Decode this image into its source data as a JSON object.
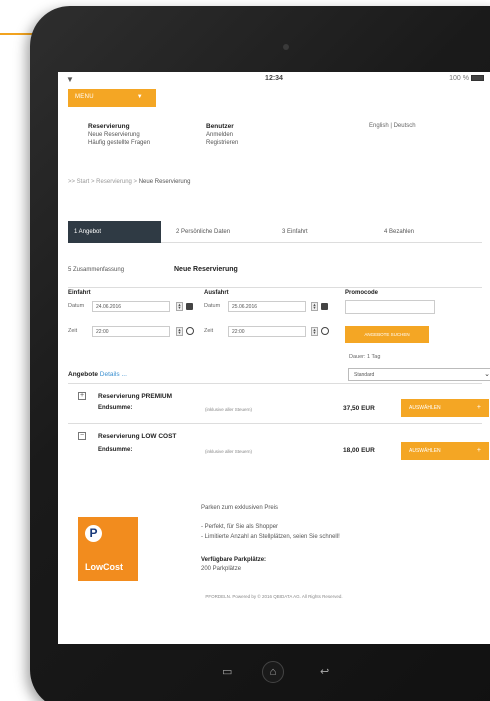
{
  "status": {
    "time": "12:34",
    "battery": "100 %"
  },
  "menu": {
    "label": "MENU"
  },
  "nav": {
    "col1": {
      "heading": "Reservierung",
      "items": [
        "Neue Reservierung",
        "Häufig gestellte Fragen"
      ]
    },
    "col2": {
      "heading": "Benutzer",
      "items": [
        "Anmelden",
        "Registrieren"
      ]
    },
    "languages": "English | Deutsch"
  },
  "breadcrumb": {
    "prefix": ">> Start > Reservierung > ",
    "current": "Neue Reservierung"
  },
  "steps": [
    "1 Angebot",
    "2 Persönliche Daten",
    "3 Einfahrt",
    "4 Bezahlen"
  ],
  "step5": "5 Zusammenfassung",
  "page_title": "Neue Reservierung",
  "form": {
    "einfahrt": {
      "heading": "Einfahrt",
      "datum_label": "Datum",
      "datum_value": "24.06.2016",
      "zeit_label": "Zeit",
      "zeit_value": "22:00"
    },
    "ausfahrt": {
      "heading": "Ausfahrt",
      "datum_label": "Datum",
      "datum_value": "25.06.2016",
      "zeit_label": "Zeit",
      "zeit_value": "22:00"
    },
    "promocode": {
      "heading": "Promocode",
      "value": ""
    },
    "search_button": "ANGEBOTE SUCHEN",
    "dauer": "Dauer: 1 Tag"
  },
  "offers": {
    "heading": "Angebote",
    "details_link": "Details ...",
    "sort_value": "Standard",
    "items": [
      {
        "toggle": "+",
        "name": "Reservierung PREMIUM",
        "sum_label": "Endsumme:",
        "note": "(inklusive aller Steuern)",
        "price": "37,50 EUR",
        "button": "AUSWÄHLEN"
      },
      {
        "toggle": "−",
        "name": "Reservierung LOW COST",
        "sum_label": "Endsumme:",
        "note": "(inklusive aller Steuern)",
        "price": "18,00 EUR",
        "button": "AUSWÄHLEN"
      }
    ],
    "lowcost_details": {
      "logo_letter": "P",
      "logo_text": "LowCost",
      "line1": "Parken zum exklusiven Preis",
      "bullet1": "- Perfekt, für Sie als Shopper",
      "bullet2": "- Limitierte Anzahl an Stellplätzen, seien Sie schnell!",
      "avail_label": "Verfügbare Parkplätze:",
      "avail_value": "200 Parkplätze"
    }
  },
  "footer": "PFORDELN. Powered by © 2016 QBIDATA AG. All Rights Reserved.",
  "colors": {
    "accent": "#f4a624",
    "active_tab": "#2f3a44",
    "link": "#3a8fd0",
    "logo": "#f28c1e"
  }
}
